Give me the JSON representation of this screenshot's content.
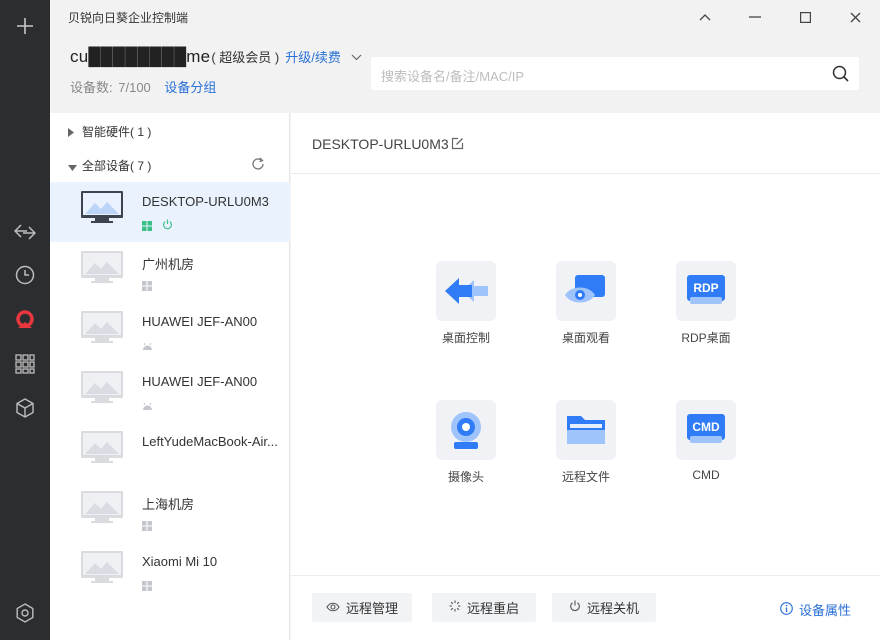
{
  "app": {
    "title": "贝锐向日葵企业控制端"
  },
  "user": {
    "name": "cu████████me",
    "level": "( 超级会员 )",
    "upgrade_label": "升级/续费",
    "device_count_label": "设备数:",
    "device_count": "7/100",
    "device_group_label": "设备分组"
  },
  "search": {
    "placeholder": "搜索设备名/备注/MAC/IP"
  },
  "tree": {
    "hardware_label": "智能硬件( 1 )",
    "all_devices_label": "全部设备( 7 )"
  },
  "devices": [
    {
      "name": "DESKTOP-URLU0M3",
      "os": "windows-icon",
      "online": true,
      "selected": true
    },
    {
      "name": "广州机房",
      "os": "windows-icon",
      "online": false
    },
    {
      "name": "HUAWEI JEF-AN00",
      "os": "android-icon",
      "online": false
    },
    {
      "name": "HUAWEI JEF-AN00",
      "os": "android-icon",
      "online": false
    },
    {
      "name": "LeftYudeMacBook-Air...",
      "os": "apple-icon",
      "online": false
    },
    {
      "name": "上海机房",
      "os": "windows-icon",
      "online": false
    },
    {
      "name": "Xiaomi Mi 10",
      "os": "windows-icon",
      "online": false
    }
  ],
  "detail": {
    "device_name": "DESKTOP-URLU0M3",
    "features": [
      {
        "label": "桌面控制",
        "icon": "desktop-control-icon"
      },
      {
        "label": "桌面观看",
        "icon": "desktop-view-icon"
      },
      {
        "label": "RDP桌面",
        "icon": "rdp-icon",
        "badge": "RDP"
      },
      {
        "label": "摄像头",
        "icon": "camera-icon"
      },
      {
        "label": "远程文件",
        "icon": "folder-icon"
      },
      {
        "label": "CMD",
        "icon": "cmd-icon",
        "badge": "CMD"
      }
    ],
    "actions": {
      "manage": "远程管理",
      "restart": "远程重启",
      "shutdown": "远程关机",
      "properties": "设备属性"
    }
  },
  "colors": {
    "accent": "#2a71d8",
    "rail": "#2b2d30",
    "online": "#3cc08a",
    "logo_red": "#e8373e"
  }
}
